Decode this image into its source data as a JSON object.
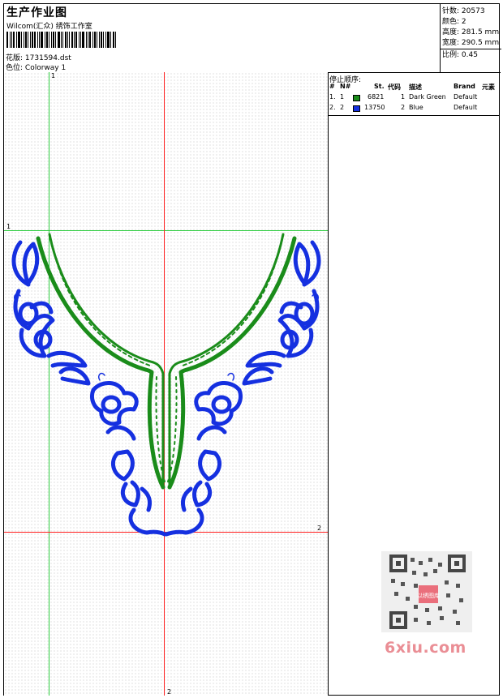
{
  "header": {
    "title": "生产作业图",
    "company": "Wilcom(汇众) 绣饰工作室",
    "file_label": "花版:",
    "file_value": "1731594.dst",
    "color_label": "色位:",
    "color_value": "Colorway 1"
  },
  "specs": {
    "stitches_label": "针数:",
    "stitches_value": "20573",
    "colors_label": "颜色:",
    "colors_value": "2",
    "height_label": "高度:",
    "height_value": "281.5 mm",
    "width_label": "宽度:",
    "width_value": "290.5 mm",
    "scale_label": "比例:",
    "scale_value": "0.45"
  },
  "panel": {
    "title": "停止顺序:",
    "columns": [
      "#",
      "N#",
      "St.",
      "代码",
      "描述",
      "Brand",
      "元素"
    ],
    "rows": [
      {
        "index": "1.",
        "needle": "1",
        "color": "#1a8c1a",
        "stitches": "6821",
        "code": "1",
        "description": "Dark Green",
        "brand": "Default"
      },
      {
        "index": "2.",
        "needle": "2",
        "color": "#1530e0",
        "stitches": "13750",
        "code": "2",
        "description": "Blue",
        "brand": "Default"
      }
    ]
  },
  "canvas": {
    "axis_labels": [
      "1",
      "1",
      "2",
      "2"
    ],
    "green_thread": "#1a8c1a",
    "blue_thread": "#1530e0"
  },
  "watermark": {
    "text": "6xiu.com",
    "qr_label": "以绣图库"
  }
}
